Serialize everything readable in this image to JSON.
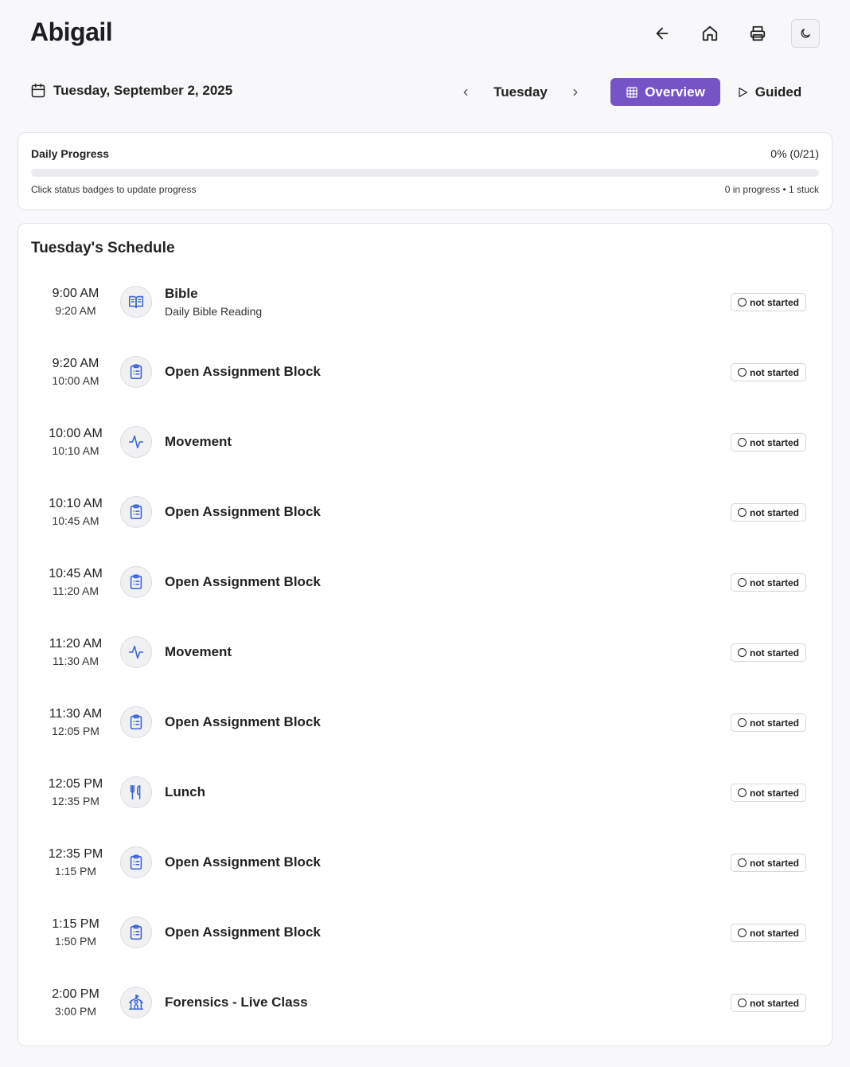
{
  "header": {
    "student_name": "Abigail",
    "actions": [
      {
        "name": "back-arrow-icon"
      },
      {
        "name": "home-icon"
      },
      {
        "name": "printer-icon"
      },
      {
        "name": "moon-icon"
      }
    ]
  },
  "date_bar": {
    "date": "Tuesday, September 2, 2025",
    "day": "Tuesday",
    "overview_label": "Overview",
    "guided_label": "Guided",
    "accent_color": "#7654c6"
  },
  "progress": {
    "title": "Daily Progress",
    "summary": "0% (0/21)",
    "percent": 0,
    "hint": "Click status badges to update progress",
    "stats": "0 in progress • 1 stuck"
  },
  "schedule": {
    "title": "Tuesday's Schedule",
    "items": [
      {
        "start": "9:00 AM",
        "end": "9:20 AM",
        "title": "Bible",
        "subtitle": "Daily Bible Reading",
        "icon": "book-open-icon",
        "status": "not started"
      },
      {
        "start": "9:20 AM",
        "end": "10:00 AM",
        "title": "Open Assignment Block",
        "subtitle": "",
        "icon": "clipboard-list-icon",
        "status": "not started"
      },
      {
        "start": "10:00 AM",
        "end": "10:10 AM",
        "title": "Movement",
        "subtitle": "",
        "icon": "activity-icon",
        "status": "not started"
      },
      {
        "start": "10:10 AM",
        "end": "10:45 AM",
        "title": "Open Assignment Block",
        "subtitle": "",
        "icon": "clipboard-list-icon",
        "status": "not started"
      },
      {
        "start": "10:45 AM",
        "end": "11:20 AM",
        "title": "Open Assignment Block",
        "subtitle": "",
        "icon": "clipboard-list-icon",
        "status": "not started"
      },
      {
        "start": "11:20 AM",
        "end": "11:30 AM",
        "title": "Movement",
        "subtitle": "",
        "icon": "activity-icon",
        "status": "not started"
      },
      {
        "start": "11:30 AM",
        "end": "12:05 PM",
        "title": "Open Assignment Block",
        "subtitle": "",
        "icon": "clipboard-list-icon",
        "status": "not started"
      },
      {
        "start": "12:05 PM",
        "end": "12:35 PM",
        "title": "Lunch",
        "subtitle": "",
        "icon": "utensils-icon",
        "status": "not started"
      },
      {
        "start": "12:35 PM",
        "end": "1:15 PM",
        "title": "Open Assignment Block",
        "subtitle": "",
        "icon": "clipboard-list-icon",
        "status": "not started"
      },
      {
        "start": "1:15 PM",
        "end": "1:50 PM",
        "title": "Open Assignment Block",
        "subtitle": "",
        "icon": "clipboard-list-icon",
        "status": "not started"
      },
      {
        "start": "2:00 PM",
        "end": "3:00 PM",
        "title": "Forensics - Live Class",
        "subtitle": "",
        "icon": "school-icon",
        "status": "not started"
      }
    ]
  }
}
